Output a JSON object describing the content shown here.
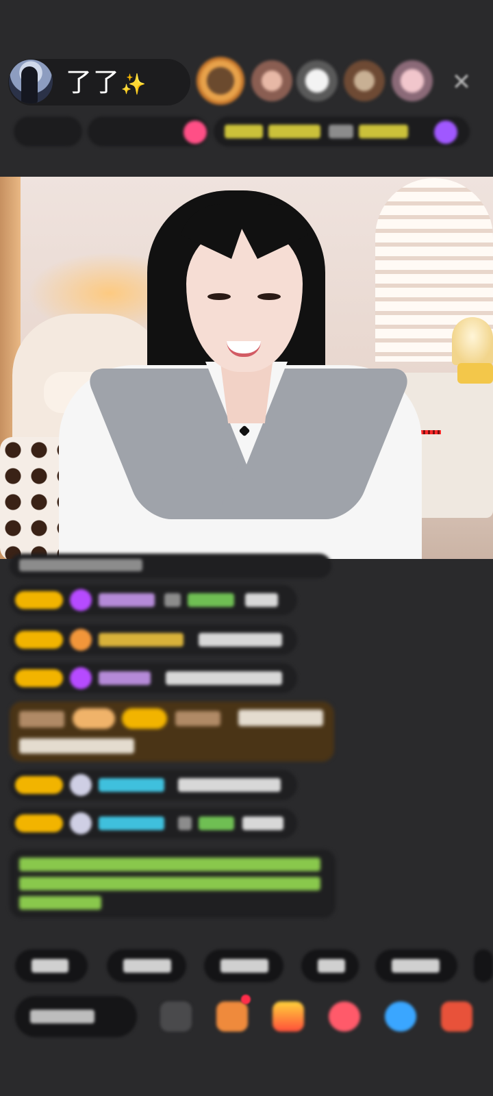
{
  "header": {
    "host_name": "了了",
    "host_name_sparkle": "✨",
    "close_glyph": "✕",
    "viewers": [
      "viewer-1",
      "viewer-2",
      "viewer-3",
      "viewer-4",
      "viewer-5"
    ]
  },
  "colors": {
    "background": "#2a2a2c",
    "badge_gold": "#f2b400",
    "notice_green": "#89c84c",
    "gift_brown": "#4a3416"
  },
  "icons": {
    "close": "close-icon",
    "gift": "gift-icon",
    "emoji": "emoji-icon"
  }
}
